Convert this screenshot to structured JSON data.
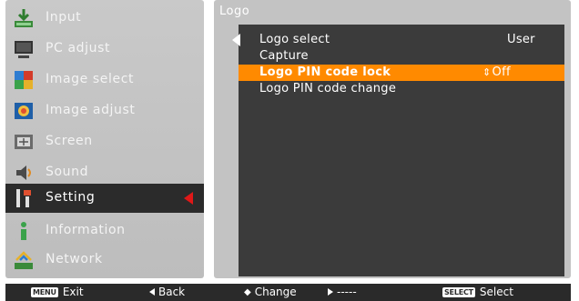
{
  "menu": {
    "items": [
      {
        "label": "Input",
        "icon": "input-icon"
      },
      {
        "label": "PC adjust",
        "icon": "pc-adjust-icon"
      },
      {
        "label": "Image select",
        "icon": "image-select-icon"
      },
      {
        "label": "Image adjust",
        "icon": "image-adjust-icon"
      },
      {
        "label": "Screen",
        "icon": "screen-icon"
      },
      {
        "label": "Sound",
        "icon": "sound-icon"
      },
      {
        "label": "Setting",
        "icon": "setting-icon",
        "selected": true
      },
      {
        "label": "Information",
        "icon": "information-icon"
      },
      {
        "label": "Network",
        "icon": "network-icon"
      }
    ]
  },
  "panel": {
    "title": "Logo",
    "rows": [
      {
        "label": "Logo select",
        "value": "User"
      },
      {
        "label": "Capture",
        "value": ""
      },
      {
        "label": "Logo PIN code lock",
        "value": "Off",
        "highlighted": true
      },
      {
        "label": "Logo PIN code change",
        "value": ""
      }
    ]
  },
  "footer": {
    "exit_key": "MENU",
    "exit_label": "Exit",
    "back_label": "Back",
    "change_label": "Change",
    "next_label": "-----",
    "select_key": "SELECT",
    "select_label": "Select"
  },
  "colors": {
    "highlight": "#ff8a00",
    "selected_arrow": "#e01818",
    "panel_bg": "#c3c3c3",
    "sub_panel_bg": "#3b3b3b"
  }
}
